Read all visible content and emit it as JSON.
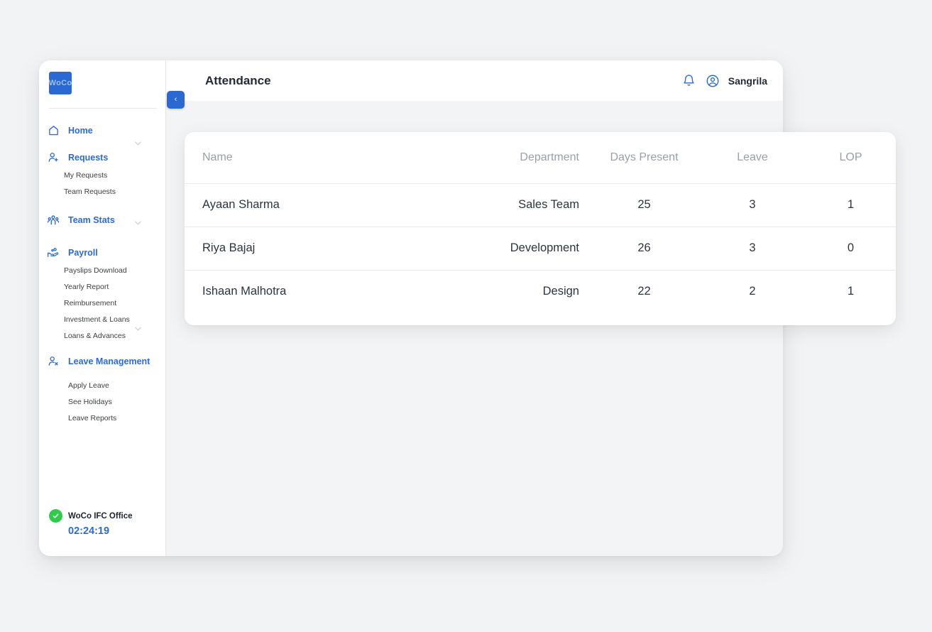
{
  "app": {
    "logo_text": "WoCo",
    "accent_color": "#2a6ae0",
    "logo_bg": "#2a69d4"
  },
  "header": {
    "title": "Attendance",
    "user_name": "Sangrila",
    "notification_icon": "bell-icon",
    "account_icon": "account-circle-icon"
  },
  "collapse_toggle": {
    "label": "‹",
    "icon": "chevron-left-icon"
  },
  "sidebar": {
    "items": [
      {
        "label": "Home",
        "icon": "home-icon",
        "type": "main",
        "active": true
      },
      {
        "label": "Requests",
        "icon": "person-add-icon",
        "type": "main",
        "has_chevron": true
      },
      {
        "label": "My Requests",
        "type": "sub"
      },
      {
        "label": "Team Requests",
        "type": "sub"
      },
      {
        "label": "Team Stats",
        "icon": "people-group-icon",
        "type": "main",
        "has_chevron": true
      },
      {
        "label": "Payroll",
        "icon": "payroll-hand-coins-icon",
        "type": "main"
      },
      {
        "label": "Payslips Download",
        "type": "sub"
      },
      {
        "label": "Yearly Report",
        "type": "sub"
      },
      {
        "label": "Reimbursement",
        "type": "sub"
      },
      {
        "label": "Investment & Loans",
        "type": "sub"
      },
      {
        "label": "Loans & Advances",
        "type": "sub",
        "has_chevron": true
      },
      {
        "label": "Leave Management",
        "icon": "person-leave-icon",
        "type": "main"
      },
      {
        "label": "Apply Leave",
        "type": "sub"
      },
      {
        "label": "See Holidays",
        "type": "sub"
      },
      {
        "label": "Leave Reports",
        "type": "sub"
      }
    ],
    "footer": {
      "status_icon": "check-circle-icon",
      "status_color": "#2ecc4a",
      "office_name": "WoCo IFC Office",
      "timer": "02:24:19"
    }
  },
  "table": {
    "columns": [
      "Name",
      "Department",
      "Days Present",
      "Leave",
      "LOP"
    ],
    "rows": [
      {
        "name": "Ayaan Sharma",
        "department": "Sales Team",
        "days_present": "25",
        "leave": "3",
        "lop": "1"
      },
      {
        "name": "Riya Bajaj",
        "department": "Development",
        "days_present": "26",
        "leave": "3",
        "lop": "0"
      },
      {
        "name": "Ishaan Malhotra",
        "department": "Design",
        "days_present": "22",
        "leave": "2",
        "lop": "1"
      }
    ]
  }
}
